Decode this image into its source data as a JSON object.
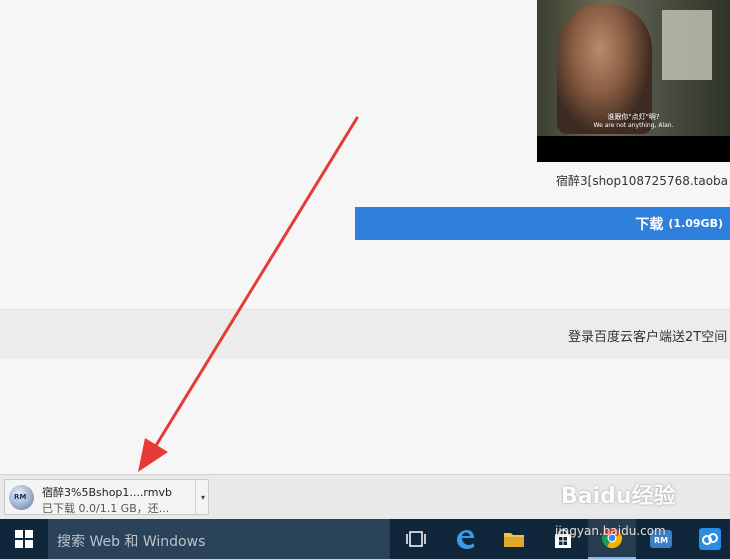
{
  "video": {
    "subtitle_cn": "谁跟你\"点灯\"啊?",
    "subtitle_en": "We are not anything, Alan.",
    "caption": "宿醉3[shop108725768.taoba"
  },
  "download_button": {
    "label": "下载",
    "size": "(1.09GB)"
  },
  "promo": {
    "text": "登录百度云客户端送2T空间"
  },
  "download_shelf": {
    "file_name": "宿醉3%5Bshop1....rmvb",
    "status": "已下载 0.0/1.1 GB，还...",
    "icon_text": "RM"
  },
  "taskbar": {
    "search_placeholder": "搜索 Web 和 Windows",
    "rm_icon_text": "RM"
  },
  "watermark": {
    "brand": "Baidu经验",
    "url": "jingyan.baidu.com"
  },
  "colors": {
    "download_button": "#2f7fdc",
    "arrow": "#e53a35",
    "taskbar": "#10273b",
    "search_box": "#2b4358"
  }
}
